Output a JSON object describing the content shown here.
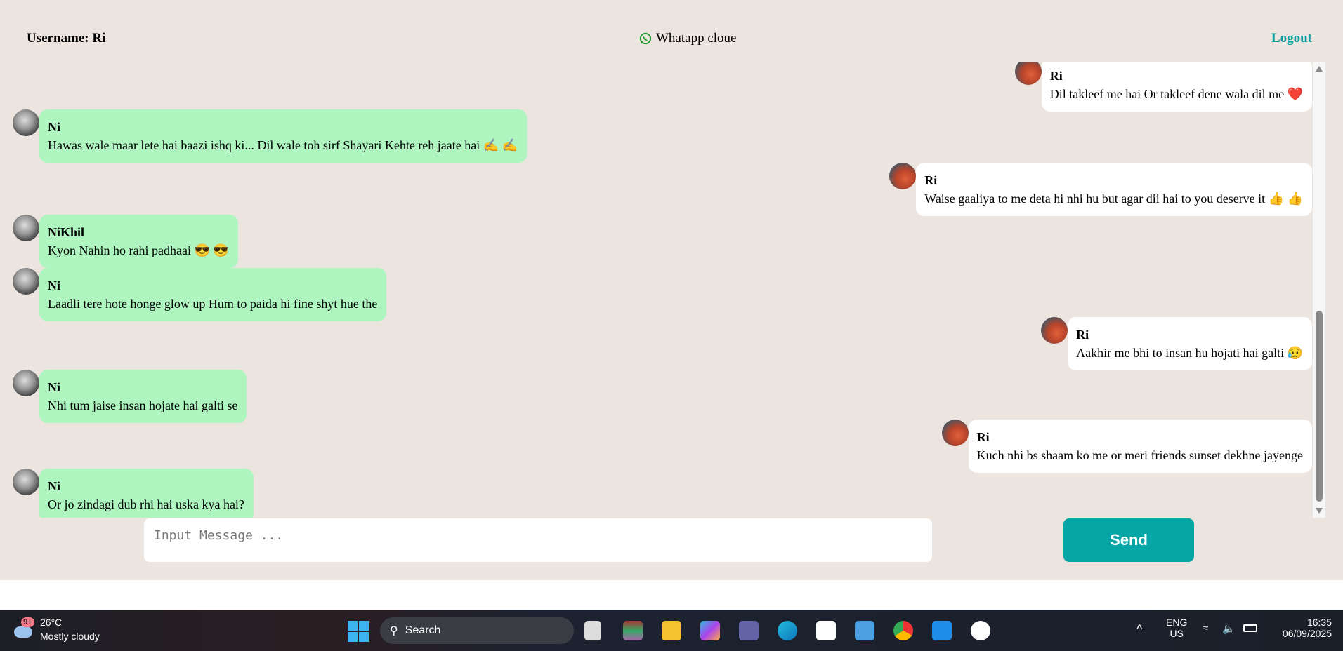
{
  "header": {
    "username_label": "Username: Ri",
    "brand": "Whatapp cloue",
    "logout": "Logout"
  },
  "messages": [
    {
      "side": "right",
      "sender": "Ri",
      "text": "Dil takleef me hai Or takleef dene wala dil me ❤️"
    },
    {
      "side": "left",
      "sender": "Ni",
      "text": "Hawas wale maar lete hai baazi ishq ki... Dil wale toh sirf Shayari Kehte reh jaate hai ✍️ ✍️"
    },
    {
      "side": "right",
      "sender": "Ri",
      "text": "Waise gaaliya to me deta hi nhi hu but agar dii hai to you deserve it 👍 👍"
    },
    {
      "side": "left",
      "sender": "NiKhil",
      "text": "Kyon Nahin ho rahi padhaai 😎 😎"
    },
    {
      "side": "left",
      "sender": "Ni",
      "text": "Laadli tere hote honge glow up Hum to paida hi fine shyt hue the"
    },
    {
      "side": "right",
      "sender": "Ri",
      "text": "Aakhir me bhi to insan hu hojati hai galti 😥"
    },
    {
      "side": "left",
      "sender": "Ni",
      "text": "Nhi tum jaise insan hojate hai galti se"
    },
    {
      "side": "right",
      "sender": "Ri",
      "text": "Kuch nhi bs shaam ko me or meri friends sunset dekhne jayenge"
    },
    {
      "side": "left",
      "sender": "Ni",
      "text": "Or jo zindagi dub rhi hai uska kya hai?"
    }
  ],
  "composer": {
    "placeholder": "Input Message ...",
    "send": "Send"
  },
  "colors": {
    "background": "#ece5df",
    "incoming_bubble": "#aef5c0",
    "outgoing_bubble": "#ffffff",
    "accent": "#06a6a6"
  },
  "taskbar": {
    "weather_badge": "9+",
    "temperature": "26°C",
    "weather": "Mostly cloudy",
    "search": "Search",
    "lang": "ENG",
    "region": "US",
    "time": "16:35",
    "date": "06/09/2025",
    "apps": [
      "task-view",
      "winrar",
      "file-explorer",
      "copilot",
      "teams",
      "edge",
      "store",
      "photos",
      "chrome",
      "vscode",
      "mongodb-compass"
    ]
  }
}
